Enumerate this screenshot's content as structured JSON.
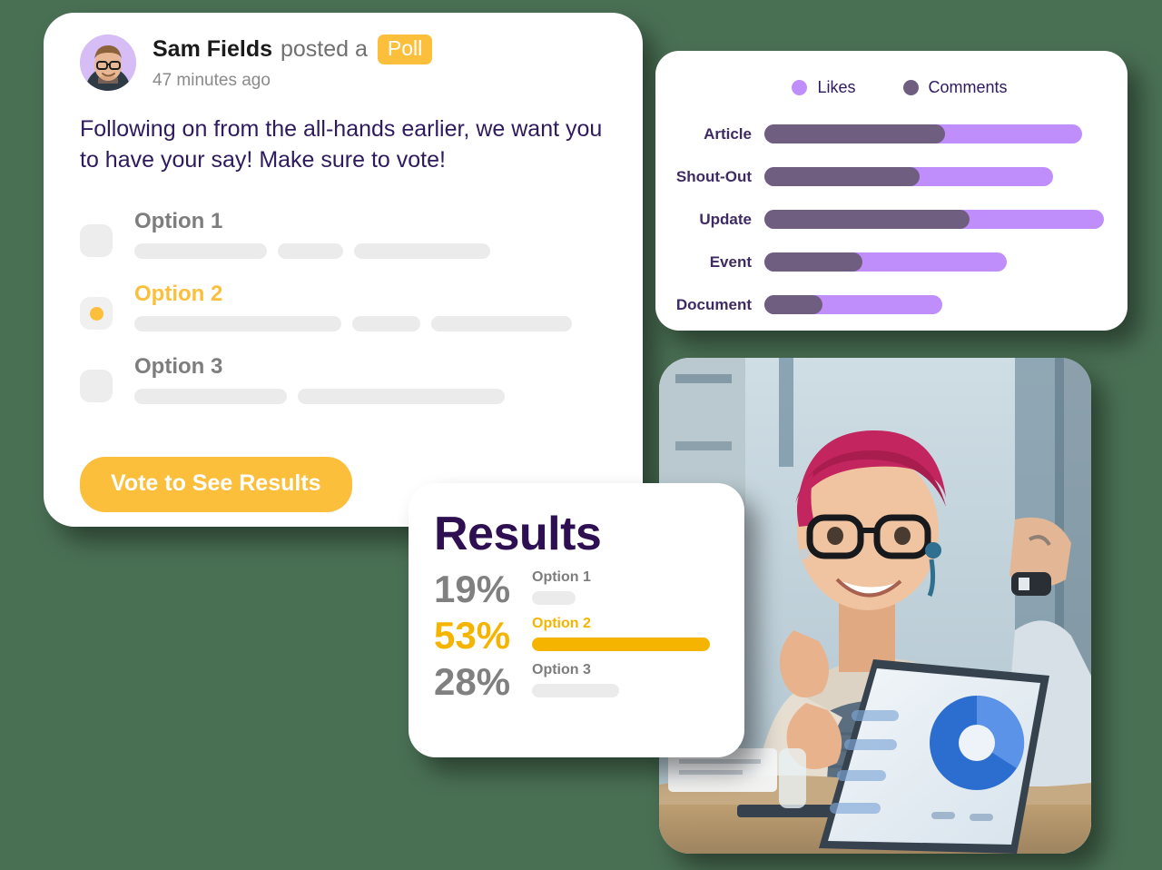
{
  "background_color": "#4A7054",
  "theme": {
    "accent_orange": "#FBBF3C",
    "result_gold": "#F5B400",
    "likes_purple": "#C08EFA",
    "comments_purple": "#6F5E80",
    "heading_purple": "#2E1A5E",
    "skeleton_gray": "#EBEBEB"
  },
  "poll_card": {
    "author": {
      "name": "Sam Fields",
      "action": "posted a",
      "badge": "Poll",
      "timestamp": "47 minutes ago",
      "avatar_alt": "avatar"
    },
    "body_text": "Following on from the all-hands earlier, we want you to have your say! Make sure to vote!",
    "options": [
      {
        "label": "Option 1",
        "selected": false,
        "skeleton_widths": [
          146,
          72,
          150
        ]
      },
      {
        "label": "Option 2",
        "selected": true,
        "skeleton_widths": [
          228,
          75,
          155
        ]
      },
      {
        "label": "Option 3",
        "selected": false,
        "skeleton_widths": [
          168,
          228
        ]
      }
    ],
    "vote_button": "Vote to See Results"
  },
  "chart_card": {
    "chart_data": {
      "type": "bar",
      "orientation": "horizontal",
      "stacked": true,
      "title": "",
      "xlabel": "",
      "ylabel": "",
      "grid": false,
      "legend_position": "top-center",
      "categories": [
        "Article",
        "Shout-Out",
        "Update",
        "Event",
        "Document"
      ],
      "series": [
        {
          "name": "Comments",
          "color": "#6F5E80",
          "values": [
            183,
            158,
            208,
            99,
            59
          ]
        },
        {
          "name": "Likes",
          "color": "#C08EFA",
          "values": [
            139,
            135,
            136,
            147,
            122
          ]
        }
      ],
      "totals": [
        322,
        293,
        344,
        246,
        181
      ],
      "xlim": [
        0,
        350
      ]
    }
  },
  "photo_card": {
    "alt": "smiling woman with pink hair and glasses in an office meeting with laptop showing a donut chart"
  },
  "results_card": {
    "title": "Results",
    "rows": [
      {
        "percent": "19%",
        "label": "Option 1",
        "value": 19,
        "highlight": false
      },
      {
        "percent": "53%",
        "label": "Option 2",
        "value": 53,
        "highlight": true
      },
      {
        "percent": "28%",
        "label": "Option 3",
        "value": 28,
        "highlight": false
      }
    ]
  }
}
